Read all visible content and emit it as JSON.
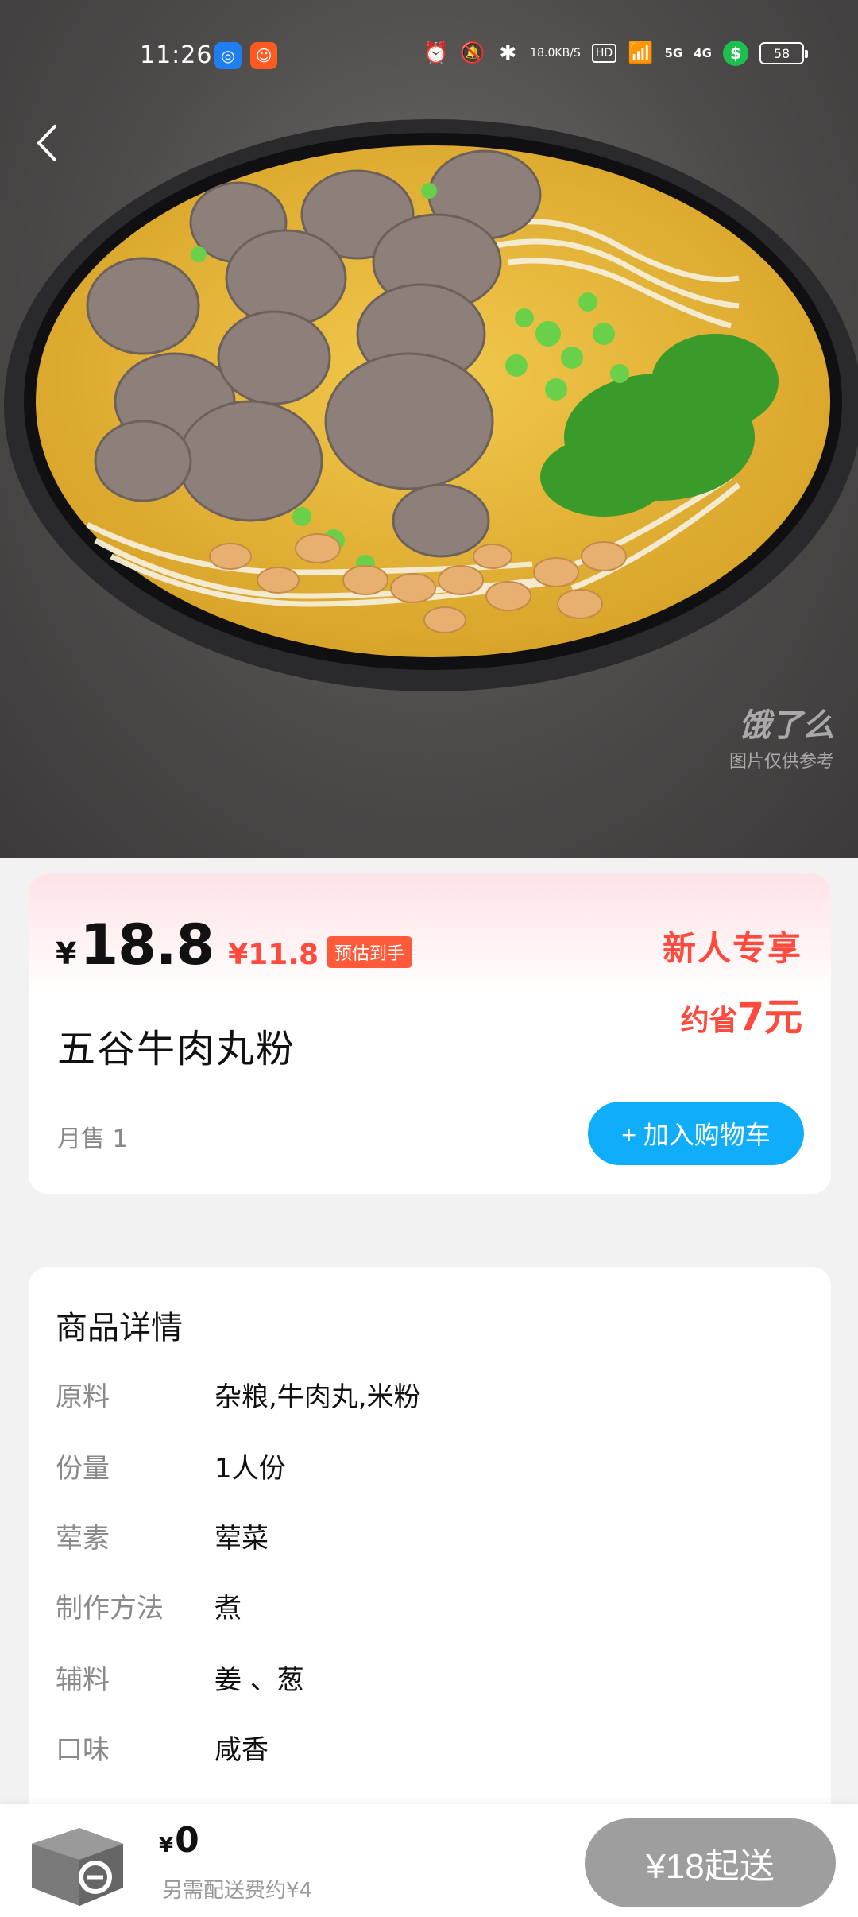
{
  "status_bar": {
    "time": "11:26",
    "net_speed": "18.0",
    "net_speed_unit": "KB/S",
    "hd_label": "HD",
    "net_5g": "5G",
    "net_4g": "4G",
    "battery": "58"
  },
  "watermark": {
    "brand": "饿了么",
    "note": "图片仅供参考"
  },
  "product": {
    "currency": "¥",
    "price": "18.8",
    "estimated_price": "¥11.8",
    "estimated_tag": "预估到手",
    "promo_title": "新人专享",
    "promo_save_prefix": "约省",
    "promo_save_amount": "7元",
    "name": "五谷牛肉丸粉",
    "monthly_sales": "月售 1",
    "add_to_cart": "+ 加入购物车"
  },
  "details": {
    "title": "商品详情",
    "attributes": [
      {
        "label": "原料",
        "value": "杂粮,牛肉丸,米粉"
      },
      {
        "label": "份量",
        "value": "1人份"
      },
      {
        "label": "荤素",
        "value": "荤菜"
      },
      {
        "label": "制作方法",
        "value": "煮"
      },
      {
        "label": "辅料",
        "value": "姜 、葱"
      },
      {
        "label": "口味",
        "value": "咸香"
      }
    ]
  },
  "cart_bar": {
    "currency": "¥",
    "total": "0",
    "delivery_fee": "另需配送费约¥4",
    "min_order": "¥18起送"
  },
  "colors": {
    "accent_red": "#ff4a3d",
    "cart_button_blue": "#10aefa",
    "disabled_gray": "#9e9e9e"
  }
}
